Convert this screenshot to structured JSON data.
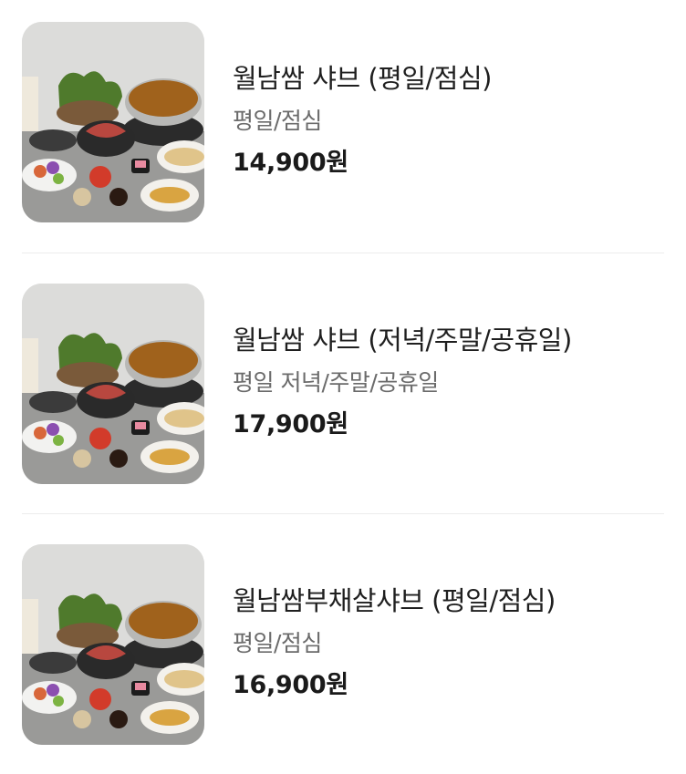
{
  "menu": {
    "items": [
      {
        "image_alt": "shabu hot pot set",
        "name": "월남쌈 샤브 (평일/점심)",
        "description": "평일/점심",
        "price": "14,900원"
      },
      {
        "image_alt": "shabu hot pot set",
        "name": "월남쌈 샤브 (저녁/주말/공휴일)",
        "description": "평일 저녁/주말/공휴일",
        "price": "17,900원"
      },
      {
        "image_alt": "shabu hot pot set",
        "name": "월남쌈부채살샤브 (평일/점심)",
        "description": "평일/점심",
        "price": "16,900원"
      }
    ]
  }
}
